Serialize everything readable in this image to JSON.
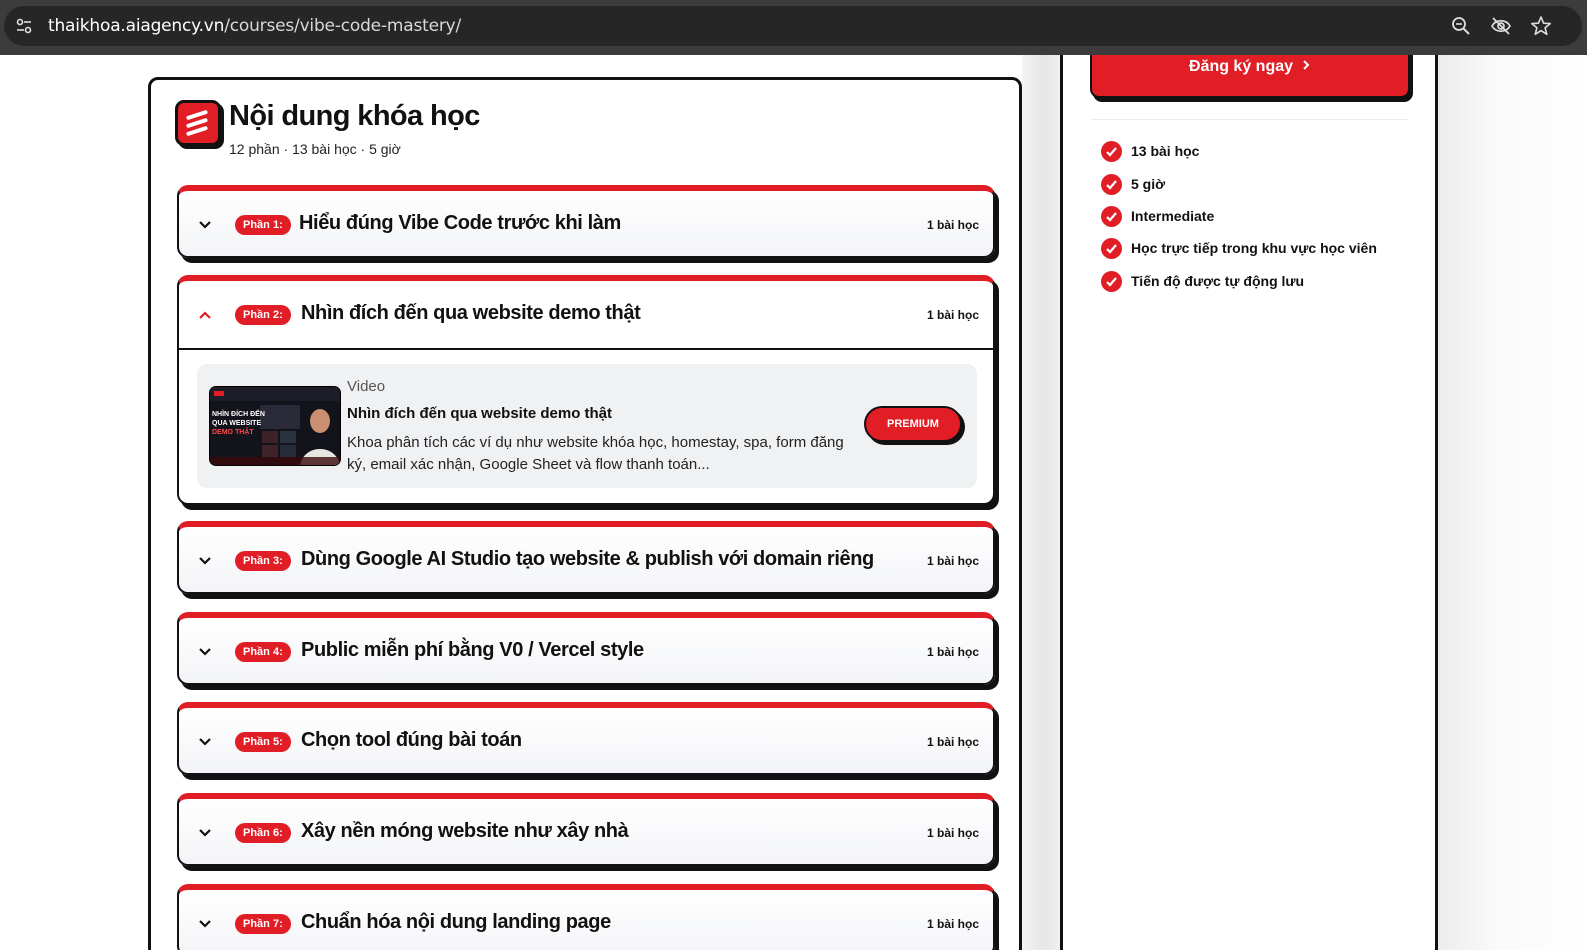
{
  "browser": {
    "url_host": "thaikhoa.aiagency.vn",
    "url_path": "/courses/vibe-code-mastery/"
  },
  "course": {
    "title": "Nội dung khóa học",
    "meta": "12 phần · 13 bài học · 5 giờ"
  },
  "sections": [
    {
      "badge": "Phần 1:",
      "title": "Hiểu đúng Vibe Code trước khi làm",
      "count": "1 bài học"
    },
    {
      "badge": "Phần 2:",
      "title": "Nhìn đích đến qua website demo thật",
      "count": "1 bài học"
    },
    {
      "badge": "Phần 3:",
      "title": "Dùng Google AI Studio tạo website & publish với domain riêng",
      "count": "1 bài học"
    },
    {
      "badge": "Phần 4:",
      "title": "Public miễn phí bằng V0 / Vercel style",
      "count": "1 bài học"
    },
    {
      "badge": "Phần 5:",
      "title": "Chọn tool đúng bài toán",
      "count": "1 bài học"
    },
    {
      "badge": "Phần 6:",
      "title": "Xây nền móng website như xây nhà",
      "count": "1 bài học"
    },
    {
      "badge": "Phần 7:",
      "title": "Chuẩn hóa nội dung landing page",
      "count": "1 bài học"
    }
  ],
  "lesson": {
    "type": "Video",
    "title": "Nhìn đích đến qua website demo thật",
    "description": "Khoa phân tích các ví dụ như website khóa học, homestay, spa, form đăng ký, email xác nhận, Google Sheet và flow thanh toán...",
    "premium_label": "PREMIUM",
    "thumb_text": [
      "NHÌN ĐÍCH ĐẾN",
      "QUA WEBSITE",
      "DEMO THẬT"
    ]
  },
  "sidebar": {
    "register_label": "Đăng ký ngay",
    "features": [
      "13 bài học",
      "5 giờ",
      "Intermediate",
      "Học trực tiếp trong khu vực học viên",
      "Tiến độ được tự động lưu"
    ]
  },
  "colors": {
    "accent": "#e11d26",
    "ink": "#111111"
  }
}
